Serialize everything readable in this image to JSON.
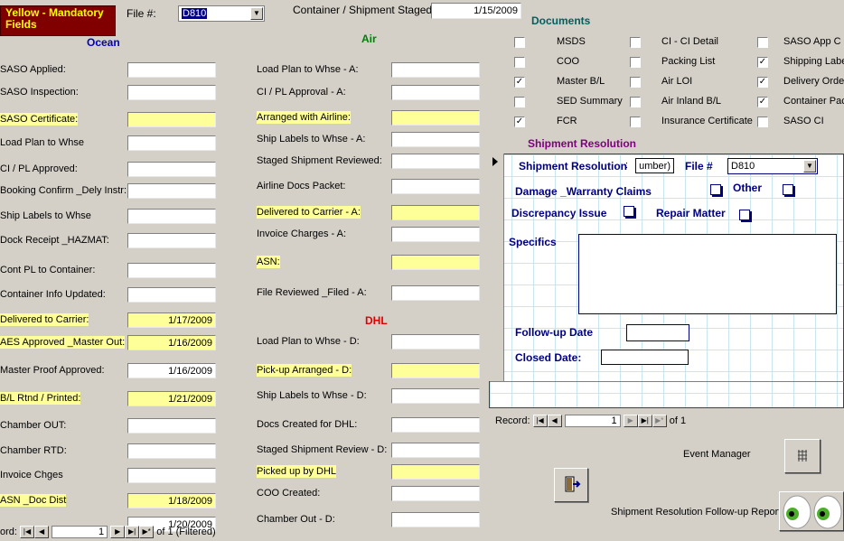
{
  "legend": "Yellow - Mandatory Fields",
  "header": {
    "file_label": "File #:",
    "file_value": "D810",
    "container_label": "Container / Shipment Staged",
    "container_value": "1/15/2009"
  },
  "ocean": {
    "title": "Ocean",
    "fields": [
      {
        "label": "SASO Applied:",
        "value": "",
        "mandatory": false
      },
      {
        "label": "SASO Inspection:",
        "value": "",
        "mandatory": false
      },
      {
        "label": "SASO Certificate:",
        "value": "",
        "mandatory": true
      },
      {
        "label": "Load Plan to Whse",
        "value": "",
        "mandatory": false
      },
      {
        "label": "CI / PL Approved:",
        "value": "",
        "mandatory": false
      },
      {
        "label": "Booking Confirm _Dely Instr:",
        "value": "",
        "mandatory": false
      },
      {
        "label": "Ship Labels to Whse",
        "value": "",
        "mandatory": false
      },
      {
        "label": "Dock Receipt _HAZMAT:",
        "value": "",
        "mandatory": false
      },
      {
        "label": "Cont PL to Container:",
        "value": "",
        "mandatory": false
      },
      {
        "label": "Container Info Updated:",
        "value": "",
        "mandatory": false
      },
      {
        "label": "Delivered to Carrier:",
        "value": "1/17/2009",
        "mandatory": true
      },
      {
        "label": "AES Approved _Master Out:",
        "value": "1/16/2009",
        "mandatory": true
      },
      {
        "label": "Master Proof Approved:",
        "value": "1/16/2009",
        "mandatory": false
      },
      {
        "label": "B/L Rtnd / Printed:",
        "value": "1/21/2009",
        "mandatory": true
      },
      {
        "label": "Chamber OUT:",
        "value": "",
        "mandatory": false
      },
      {
        "label": "Chamber RTD:",
        "value": "",
        "mandatory": false
      },
      {
        "label": "Invoice Chges",
        "value": "",
        "mandatory": false
      },
      {
        "label": "ASN _Doc Dist",
        "value": "1/18/2009",
        "mandatory": true
      },
      {
        "label": "",
        "value": "1/20/2009",
        "mandatory": false
      }
    ]
  },
  "air": {
    "title": "Air",
    "fields": [
      {
        "label": "Load Plan to Whse - A:",
        "value": "",
        "mandatory": false
      },
      {
        "label": "CI / PL Approval - A:",
        "value": "",
        "mandatory": false
      },
      {
        "label": "Arranged with Airline:",
        "value": "",
        "mandatory": true
      },
      {
        "label": "Ship Labels to Whse - A:",
        "value": "",
        "mandatory": false
      },
      {
        "label": "Staged Shipment Reviewed:",
        "value": "",
        "mandatory": false
      },
      {
        "label": "Airline Docs Packet:",
        "value": "",
        "mandatory": false
      },
      {
        "label": "Delivered to Carrier - A:",
        "value": "",
        "mandatory": true
      },
      {
        "label": "Invoice Charges - A:",
        "value": "",
        "mandatory": false
      },
      {
        "label": "ASN:",
        "value": "",
        "mandatory": true
      },
      {
        "label": "File Reviewed _Filed - A:",
        "value": "",
        "mandatory": false
      }
    ]
  },
  "dhl": {
    "title": "DHL",
    "fields": [
      {
        "label": "Load Plan to Whse - D:",
        "value": "",
        "mandatory": false
      },
      {
        "label": "Pick-up Arranged - D:",
        "value": "",
        "mandatory": true
      },
      {
        "label": "Ship Labels to Whse - D:",
        "value": "",
        "mandatory": false
      },
      {
        "label": "Docs Created for DHL:",
        "value": "",
        "mandatory": false
      },
      {
        "label": "Staged Shipment Review - D:",
        "value": "",
        "mandatory": false
      },
      {
        "label": "Picked up by DHL",
        "value": "",
        "mandatory": true
      },
      {
        "label": "COO Created:",
        "value": "",
        "mandatory": false
      },
      {
        "label": "Chamber Out - D:",
        "value": "",
        "mandatory": false
      }
    ]
  },
  "documents": {
    "title": "Documents",
    "items": [
      {
        "label": "MSDS",
        "checked": false
      },
      {
        "label": "COO",
        "checked": false
      },
      {
        "label": "Master B/L",
        "checked": true
      },
      {
        "label": "SED Summary",
        "checked": false
      },
      {
        "label": "FCR",
        "checked": true
      },
      {
        "label": "CI - CI Detail",
        "checked": false
      },
      {
        "label": "Packing List",
        "checked": false
      },
      {
        "label": "Air LOI",
        "checked": false
      },
      {
        "label": "Air Inland B/L",
        "checked": false
      },
      {
        "label": "Insurance Certificate",
        "checked": false
      },
      {
        "label": "SASO App C",
        "checked": false
      },
      {
        "label": "Shipping Labels",
        "checked": true
      },
      {
        "label": "Delivery Order",
        "checked": true
      },
      {
        "label": "Container Pack",
        "checked": true
      },
      {
        "label": "SASO CI",
        "checked": false
      }
    ]
  },
  "resolution": {
    "title": "Shipment Resolution",
    "sr_label": "Shipment Resolution",
    "sr_value": "umber)",
    "file_label": "File #",
    "file_value": "D810",
    "damage_label": "Damage _Warranty Claims",
    "other_label": "Other",
    "discrepancy_label": "Discrepancy Issue",
    "repair_label": "Repair Matter",
    "specifics_label": "Specifics",
    "followup_label": "Follow-up Date",
    "closed_label": "Closed Date:",
    "nav": {
      "label": "Record:",
      "current": "1",
      "of_text": "of",
      "total": "1"
    }
  },
  "main_nav": {
    "label": "ord:",
    "current": "1",
    "of_text": "of",
    "total": "1 (Filtered)"
  },
  "event_manager_label": "Event Manager",
  "followup_report_label": "Shipment Resolution Follow-up Report"
}
